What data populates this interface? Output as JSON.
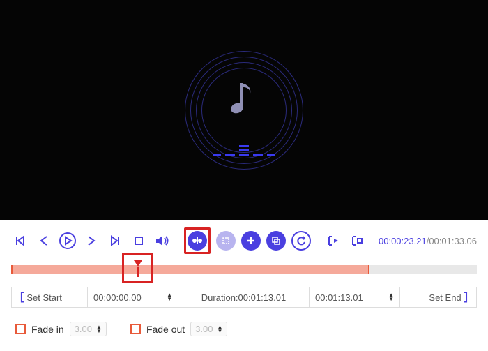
{
  "preview": {
    "icon": "music-note-icon"
  },
  "toolbar": {
    "items": [
      {
        "name": "seek-start-icon"
      },
      {
        "name": "step-back-icon"
      },
      {
        "name": "play-icon"
      },
      {
        "name": "step-forward-icon"
      },
      {
        "name": "seek-end-icon"
      },
      {
        "name": "stop-icon"
      },
      {
        "name": "volume-icon"
      }
    ],
    "actionItems": [
      {
        "name": "split-icon",
        "highlighted": true
      },
      {
        "name": "crop-icon",
        "disabled": true
      },
      {
        "name": "add-icon"
      },
      {
        "name": "copy-icon"
      },
      {
        "name": "undo-icon"
      }
    ],
    "markerItems": [
      {
        "name": "mark-in-icon"
      },
      {
        "name": "mark-out-icon"
      }
    ]
  },
  "timecode": {
    "current": "00:00:23.21",
    "total": "00:01:33.06"
  },
  "timeline": {
    "playhead_pct": 25,
    "selection_pct": 77
  },
  "range": {
    "setStart": "Set Start",
    "startValue": "00:00:00.00",
    "durationLabel": "Duration:",
    "durationValue": "00:01:13.01",
    "endValue": "00:01:13.01",
    "setEnd": "Set End"
  },
  "fade": {
    "inLabel": "Fade in",
    "inValue": "3.00",
    "outLabel": "Fade out",
    "outValue": "3.00"
  }
}
